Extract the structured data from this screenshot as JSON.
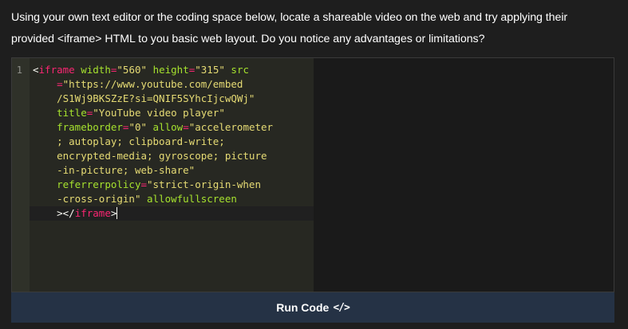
{
  "instructions": {
    "line1": "Using your own text editor or the coding space below, locate a shareable video on the web and try applying their",
    "line2": "provided <iframe> HTML to you basic web layout. Do you notice any advantages or limitations?"
  },
  "editor": {
    "line_number": "1",
    "tokens": {
      "open_bracket": "<",
      "tag_name": "iframe",
      "attr_width": "width",
      "eq": "=",
      "val_width": "\"560\"",
      "attr_height": "height",
      "val_height": "\"315\"",
      "attr_src": "src",
      "val_src_1": "\"https://www.youtube.com/embed",
      "val_src_2": "/S1Wj9BKSZzE?si=QNIF5SYhcIjcwQWj\"",
      "attr_title": "title",
      "val_title": "\"YouTube video player\"",
      "attr_frameborder": "frameborder",
      "val_frameborder": "\"0\"",
      "attr_allow": "allow",
      "val_allow_1": "\"accelerometer",
      "val_allow_2": "; autoplay; clipboard-write;",
      "val_allow_3": "encrypted-media; gyroscope; picture",
      "val_allow_4": "-in-picture; web-share\"",
      "attr_referrerpolicy": "referrerpolicy",
      "val_referrerpolicy_1": "\"strict-origin-when",
      "val_referrerpolicy_2": "-cross-origin\"",
      "attr_allowfullscreen": "allowfullscreen",
      "close_bracket": ">",
      "end_tag_open": "</",
      "close_tag_end": ">"
    }
  },
  "run_button": {
    "label": "Run Code",
    "icon_glyph": "</>"
  },
  "colors": {
    "tag": "#f92672",
    "attribute": "#a6e22e",
    "string": "#e6db74",
    "editor_bg": "#272822",
    "button_bg": "#253245"
  }
}
